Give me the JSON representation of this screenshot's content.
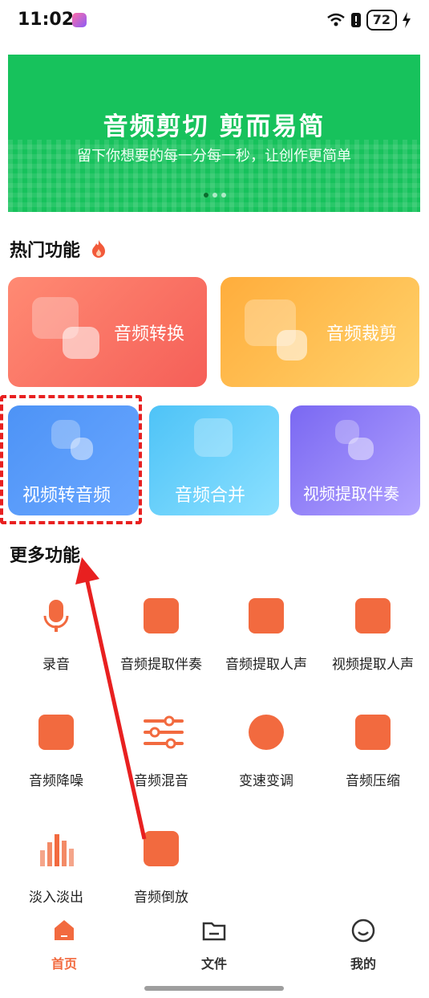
{
  "status_bar": {
    "time": "11:02",
    "battery": "72"
  },
  "banner": {
    "title": "音频剪切 剪而易简",
    "subtitle": "留下你想要的每一分每一秒，让创作更简单",
    "page_count": 3,
    "active_page": 1
  },
  "hot": {
    "section_title": "热门功能",
    "cards": [
      {
        "label": "音频转换"
      },
      {
        "label": "音频裁剪"
      },
      {
        "label": "视频转音频"
      },
      {
        "label": "音频合并"
      },
      {
        "label": "视频提取伴奏"
      }
    ]
  },
  "more": {
    "section_title": "更多功能",
    "items": [
      {
        "label": "录音",
        "icon": "microphone-icon"
      },
      {
        "label": "音频提取伴奏",
        "icon": "music-extract-accompaniment-icon"
      },
      {
        "label": "音频提取人声",
        "icon": "music-extract-vocal-icon"
      },
      {
        "label": "视频提取人声",
        "icon": "video-extract-vocal-icon"
      },
      {
        "label": "音频降噪",
        "icon": "noise-reduction-icon"
      },
      {
        "label": "音频混音",
        "icon": "mixer-sliders-icon"
      },
      {
        "label": "变速变调",
        "icon": "speed-dial-icon"
      },
      {
        "label": "音频压缩",
        "icon": "music-compress-icon"
      },
      {
        "label": "淡入淡出",
        "icon": "fade-bars-icon"
      },
      {
        "label": "音频倒放",
        "icon": "music-reverse-icon"
      }
    ]
  },
  "tabbar": {
    "tabs": [
      {
        "label": "首页",
        "active": true
      },
      {
        "label": "文件",
        "active": false
      },
      {
        "label": "我的",
        "active": false
      }
    ]
  },
  "colors": {
    "accent": "#f26a3f",
    "banner_green": "#17c25c",
    "highlight_red": "#e82020"
  }
}
